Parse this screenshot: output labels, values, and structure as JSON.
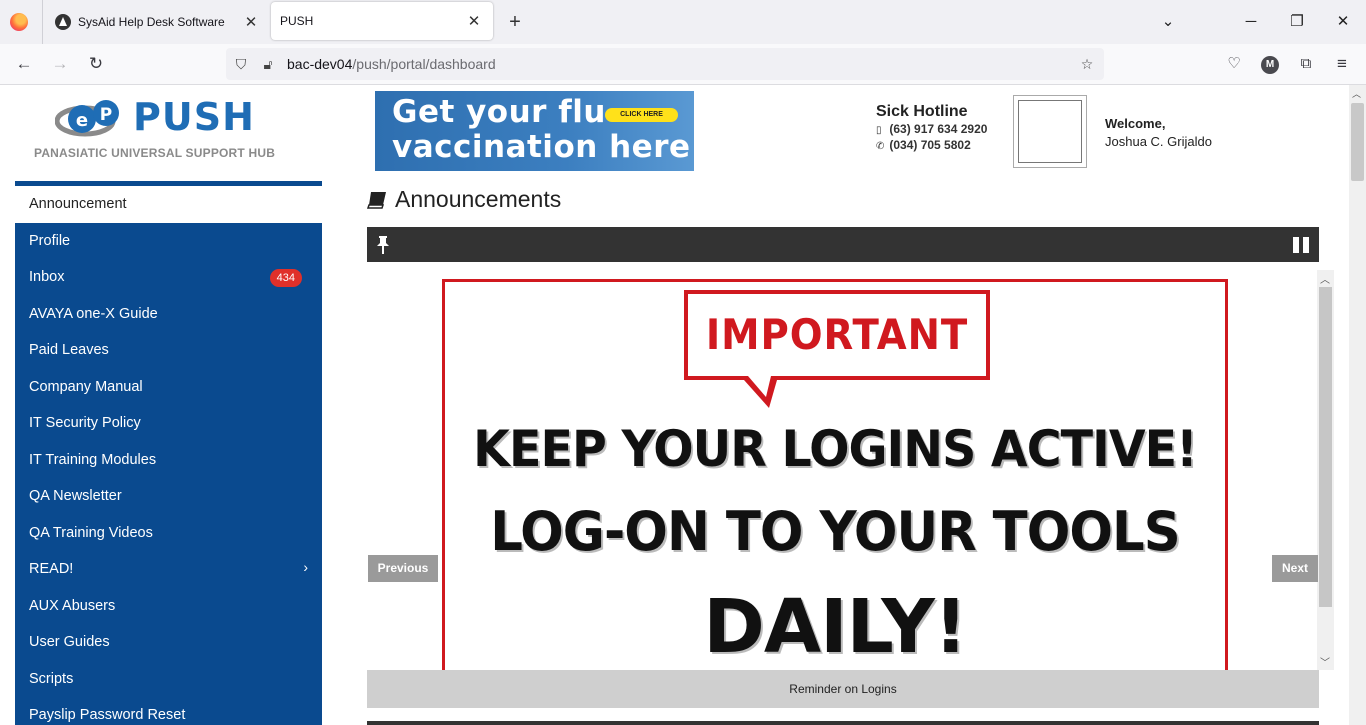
{
  "browser": {
    "tabs": [
      {
        "title": "SysAid Help Desk Software",
        "close": "✕"
      },
      {
        "title": "PUSH",
        "close": "✕"
      }
    ],
    "new_tab": "+",
    "window_controls": {
      "dropdown": "⌄",
      "minimize": "─",
      "restore": "❐",
      "close": "✕"
    },
    "url": {
      "host": "bac-dev04",
      "path": "/push/portal/dashboard"
    },
    "profile_initial": "M"
  },
  "logo": {
    "word": "PUSH",
    "subtitle": "PANASIATIC UNIVERSAL SUPPORT HUB"
  },
  "sidebar": {
    "items": [
      {
        "label": "Announcement"
      },
      {
        "label": "Profile"
      },
      {
        "label": "Inbox",
        "badge": "434"
      },
      {
        "label": "AVAYA one-X Guide"
      },
      {
        "label": "Paid Leaves"
      },
      {
        "label": "Company Manual"
      },
      {
        "label": "IT Security Policy"
      },
      {
        "label": "IT Training Modules"
      },
      {
        "label": "QA Newsletter"
      },
      {
        "label": "QA Training Videos"
      },
      {
        "label": "READ!",
        "chevron": "›"
      },
      {
        "label": "AUX Abusers"
      },
      {
        "label": "User Guides"
      },
      {
        "label": "Scripts"
      },
      {
        "label": "Payslip Password Reset"
      }
    ]
  },
  "banner": {
    "line1": "Get your flu",
    "line2": "vaccination here",
    "cta": "CLICK HERE"
  },
  "hotline": {
    "title": "Sick Hotline",
    "mobile": "(63) 917 634 2920",
    "phone": "(034) 705 5802"
  },
  "user": {
    "welcome": "Welcome,",
    "name": "Joshua C. Grijaldo"
  },
  "announcements": {
    "heading": "Announcements",
    "slide": {
      "bubble": "IMPORTANT",
      "line1": "KEEP YOUR LOGINS ACTIVE!",
      "line2": "LOG-ON TO YOUR TOOLS",
      "line3": "DAILY!"
    },
    "prev": "Previous",
    "next": "Next",
    "caption": "Reminder on Logins"
  },
  "colors": {
    "sidebar": "#0a4a8f",
    "brand_blue": "#1f6db5",
    "alert_red": "#d0191f",
    "badge_red": "#e0302a"
  }
}
